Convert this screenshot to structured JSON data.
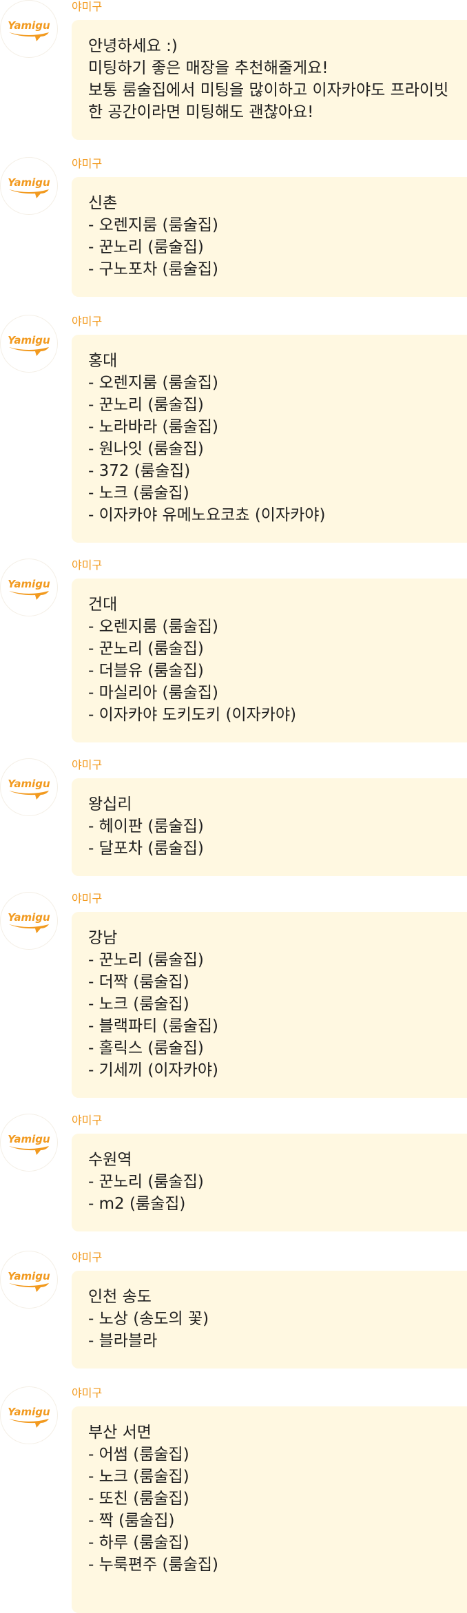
{
  "sender_name": "야미구",
  "logo_text": "Yamigu",
  "brand_color": "#f29a1f",
  "bubble_color": "#fff8e1",
  "messages": [
    {
      "lines": [
        "안녕하세요 :)",
        "미팅하기 좋은 매장을 추천해줄게요!",
        "보통 룸술집에서 미팅을 많이하고 이자카야도 프라이빗",
        "한 공간이라면 미팅해도 괜찮아요!"
      ]
    },
    {
      "lines": [
        "신촌",
        "- 오렌지룸 (룸술집)",
        "- 꾼노리 (룸술집)",
        "- 구노포차 (룸술집)"
      ]
    },
    {
      "lines": [
        "홍대",
        "- 오렌지룸 (룸술집)",
        "- 꾼노리 (룸술집)",
        "- 노라바라 (룸술집)",
        "- 원나잇 (룸술집)",
        "- 372 (룸술집)",
        "- 노크 (룸술집)",
        "- 이자카야 유메노요코쵸 (이자카야)"
      ]
    },
    {
      "lines": [
        "건대",
        "- 오렌지룸 (룸술집)",
        "- 꾼노리 (룸술집)",
        "- 더블유 (룸술집)",
        "- 마실리아 (룸술집)",
        "- 이자카야 도키도키 (이자카야)"
      ]
    },
    {
      "lines": [
        "왕십리",
        "- 헤이판 (룸술집)",
        "- 달포차 (룸술집)"
      ]
    },
    {
      "lines": [
        "강남",
        "- 꾼노리 (룸술집)",
        "- 더짝 (룸술집)",
        "- 노크 (룸술집)",
        "- 블랙파티 (룸술집)",
        "- 홀릭스 (룸술집)",
        "- 기세끼 (이자카야)"
      ]
    },
    {
      "lines": [
        "수원역",
        "- 꾼노리 (룸술집)",
        "- m2 (룸술집)"
      ]
    },
    {
      "lines": [
        "인천 송도",
        "- 노상 (송도의 꽃)",
        "- 블라블라"
      ]
    },
    {
      "lines": [
        "부산 서면",
        "- 어썸 (룸술집)",
        "- 노크 (룸술집)",
        "- 또친 (룸술집)",
        "- 짝 (룸술집)",
        "- 하루 (룸술집)",
        "- 누룩편주 (룸술집)"
      ]
    }
  ]
}
